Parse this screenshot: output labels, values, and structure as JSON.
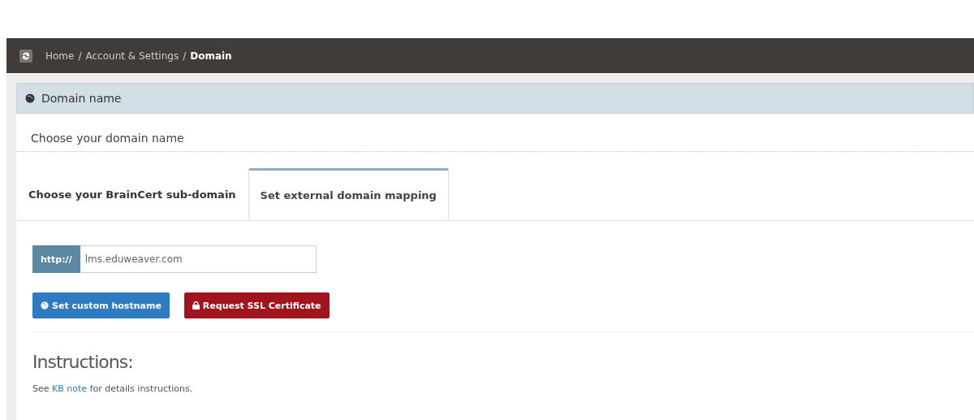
{
  "breadcrumb": {
    "items": [
      {
        "label": "Home",
        "current": false
      },
      {
        "label": "Account & Settings",
        "current": false
      },
      {
        "label": "Domain",
        "current": true
      }
    ],
    "separator": "/"
  },
  "panel": {
    "title": "Domain name",
    "subtitle": "Choose your domain name"
  },
  "tabs": [
    {
      "label": "Choose your BrainCert sub-domain",
      "selected": false
    },
    {
      "label": "Set external domain mapping",
      "selected": true
    }
  ],
  "hostname_field": {
    "prefix": "http://",
    "value": "lms.eduweaver.com"
  },
  "buttons": [
    {
      "label": "Set custom hostname",
      "kind": "primary"
    },
    {
      "label": "Request SSL Certificate",
      "kind": "danger"
    }
  ],
  "instructions": {
    "heading": "Instructions:",
    "text_before": "See",
    "link": "KB note",
    "text_after": "for details instructions."
  }
}
